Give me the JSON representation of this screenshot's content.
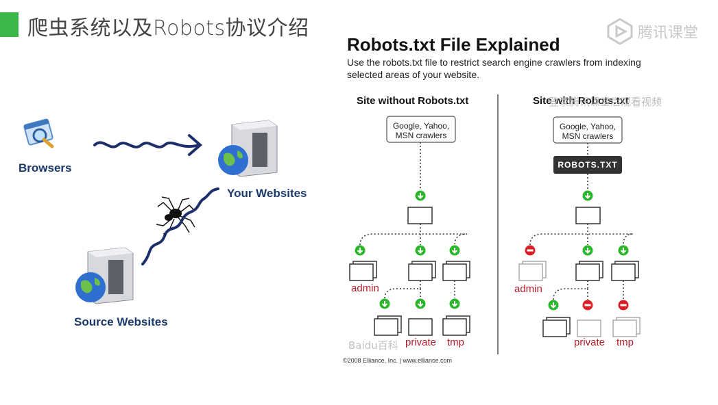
{
  "slide": {
    "title": "爬虫系统以及Robots协议介绍",
    "brand": "腾讯课堂",
    "overlay_label": "登录腾讯课堂后观看视频"
  },
  "left_diagram": {
    "browsers_label": "Browsers",
    "your_websites_label": "Your Websites",
    "source_websites_label": "Source Websites"
  },
  "figure": {
    "title": "Robots.txt File Explained",
    "subtitle": "Use the robots.txt file to restrict search engine crawlers from indexing selected areas of your website.",
    "left_heading": "Site without Robots.txt",
    "right_heading": "Site with Robots.txt",
    "crawler_box": "Google, Yahoo, MSN crawlers",
    "robots_box": "ROBOTS.TXT",
    "admin": "admin",
    "private": "private",
    "tmp": "tmp",
    "watermark": "Baidu百科",
    "copyright": "©2008 Elliance, Inc.   |   www.elliance.com"
  },
  "colors": {
    "accent_green": "#3bb64a",
    "allow_green": "#2bb52b",
    "deny_red": "#d81f26",
    "label_blue": "#1b3a6b"
  }
}
